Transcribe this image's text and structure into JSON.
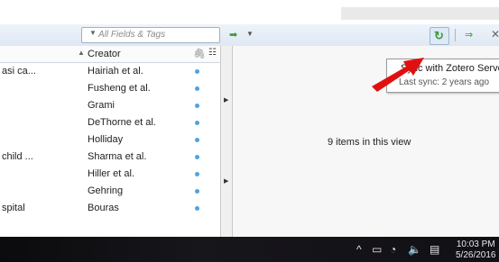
{
  "toolbar": {
    "search_placeholder": "All Fields & Tags",
    "search_mode_icon": "dropdown-arrow",
    "locate_icon": "locate-arrow",
    "sync_icon": "sync-icon",
    "fullscreen_icon": "fullscreen-icon",
    "close_icon": "close-icon"
  },
  "items_table": {
    "creator_header": "Creator",
    "rows": [
      {
        "title": "asi ca...",
        "creator": "Hairiah et al."
      },
      {
        "title": "",
        "creator": "Fusheng et al."
      },
      {
        "title": "",
        "creator": "Grami"
      },
      {
        "title": "",
        "creator": "DeThorne et al."
      },
      {
        "title": "",
        "creator": "Holliday"
      },
      {
        "title": "child ...",
        "creator": "Sharma et al."
      },
      {
        "title": "",
        "creator": "Hiller et al."
      },
      {
        "title": "",
        "creator": "Gehring"
      },
      {
        "title": "spital",
        "creator": "Bouras"
      }
    ]
  },
  "right_pane": {
    "items_count_text": "9 items in this view"
  },
  "tooltip": {
    "line1": "Sync with Zotero Server",
    "line2": "Last sync: 2 years ago"
  },
  "taskbar": {
    "time": "10:03 PM",
    "date": "5/26/2016"
  },
  "colors": {
    "toolbar_bg": "#e4ecf6",
    "attachment_dot": "#4fa3e0",
    "arrow_red": "#e01010",
    "taskbar_bg": "#121116"
  }
}
